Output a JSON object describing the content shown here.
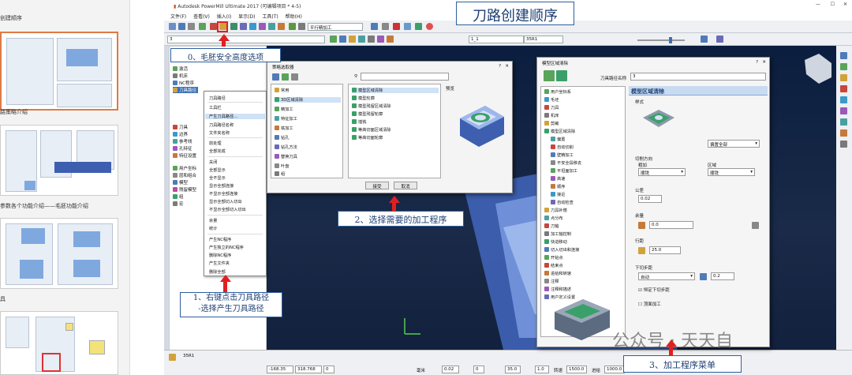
{
  "slides": {
    "labels": [
      "创建顺序",
      "路策略介绍",
      "参数各个功能介绍——毛胚功能介绍",
      "具"
    ]
  },
  "app": {
    "title": "Autodesk PowerMill Ultimate 2017    (可编辑项目 * 4-5)",
    "menu": [
      "文件(F)",
      "查看(V)",
      "插入(I)",
      "显示(D)",
      "工具(T)",
      "帮助(H)"
    ],
    "toolbar_combo1": "平行精加工",
    "toolbar_combo2": "3",
    "toolbar_combo3": "1_1",
    "toolbar_combo4": "35R1"
  },
  "tree": [
    "激活",
    "机床",
    "NC程序",
    "刀具路径",
    "刀具",
    "边界",
    "参考线",
    "孔特征",
    "特征设置",
    "用户坐标",
    "层和组合",
    "模型",
    "残留模型",
    "组",
    "宏"
  ],
  "context_menu": {
    "items": [
      "刀具路径",
      "工具栏",
      "产生刀具路径...",
      "刀具路径名称",
      "文件夹名称",
      "前处理",
      "全部完成",
      "关闭",
      "全部显示",
      "全不显示",
      "显示全部连接",
      "不显示全部连接",
      "显示全部切入切出",
      "不显示全部切入切出",
      "余量",
      "统计",
      "产生NC程序",
      "产生独立的NC程序",
      "删除NC程序",
      "产生文件夹",
      "删除全部"
    ]
  },
  "dialog1": {
    "title": "策略选取器",
    "categories": [
      "常用",
      "3D区域清除",
      "精加工",
      "特征加工",
      "铣加工",
      "钻孔",
      "钻孔方法",
      "替换刀具",
      "叶盘",
      "组"
    ],
    "strategies": [
      "模型区域清除",
      "模型轮廓",
      "模型残留区域清除",
      "模型残留轮廓",
      "插铣",
      "等高切面区域清除",
      "等高切面轮廓"
    ],
    "preview_label": "预览",
    "accept": "接受",
    "cancel": "取消"
  },
  "dialog2": {
    "title": "模型区域清除",
    "name_label": "刀具路径名称",
    "name_value": "3",
    "header": "模型区域清除",
    "style_label": "样式",
    "style_value": "偏置全部",
    "cut_dir_label": "切削方向",
    "rough_label": "粗加",
    "area_label": "区域",
    "climb": "顺铣",
    "tolerance_label": "公差",
    "tolerance_value": "0.02",
    "allowance_label": "余量",
    "allowance_value": "0.0",
    "stepover_label": "行距",
    "stepover_value": "25.0",
    "stepdown_label": "下切步距",
    "stepdown_mode": "自动",
    "stepdown_value": "0.2",
    "const_step": "恒定下切步距",
    "finish_pass": "顶面加工",
    "tree": [
      "用户坐标系",
      "毛坯",
      "刀具",
      "机床",
      "剪裁",
      "模型区域清除",
      "偏置",
      "自动切削",
      "壁精加工",
      "不安全段移去",
      "平坦面加工",
      "高速",
      "顺序",
      "接近",
      "自动检查",
      "刀具补偿",
      "点分布",
      "刀轴",
      "加工轴控制",
      "快进移动",
      "切入切出和连接",
      "开始点",
      "结束点",
      "进给和转速",
      "注释",
      "注释和描述",
      "用户定义设置"
    ]
  },
  "statusbar": {
    "coords": [
      "-168.35",
      "318.768",
      "0"
    ],
    "tool": "35R1",
    "vals": [
      "0.02",
      "0",
      "35.0",
      "1.0",
      "1500.0",
      "1000.0"
    ],
    "labels": [
      "毫米",
      "转速",
      "进给"
    ]
  },
  "annotations": {
    "top": "刀路创建顺序",
    "a0": "0、毛胚安全高度选项",
    "a1_line1": "1、右键点击刀具路径",
    "a1_line2": "-选择产生刀具路径",
    "a2": "2、选择需要的加工程序",
    "a3": "3、加工程序菜单"
  },
  "watermark": "公众号 · 天天自"
}
